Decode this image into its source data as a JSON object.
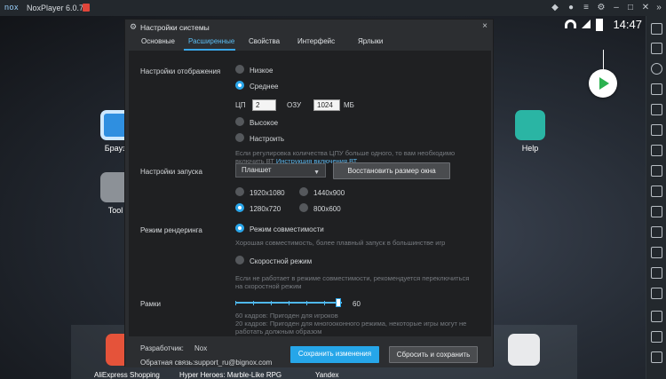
{
  "emulator": {
    "logo": "nox",
    "title": "NoxPlayer 6.0.7.2"
  },
  "statusbar": {
    "time": "14:47"
  },
  "home": {
    "apps": [
      {
        "label": "Брауз"
      },
      {
        "label": "Help"
      },
      {
        "label": "Tool"
      }
    ],
    "dock": [
      {
        "label": "AliExpress Shopping"
      },
      {
        "label": "Hyper Heroes: Marble-Like RPG"
      },
      {
        "label": "Yandex"
      }
    ]
  },
  "dialog": {
    "title": "Настройки системы",
    "tabs": [
      {
        "label": "Основные"
      },
      {
        "label": "Расширенные"
      },
      {
        "label": "Свойства"
      },
      {
        "label": "Интерфейс"
      },
      {
        "label": "Ярлыки"
      }
    ],
    "active_tab": "Расширенные",
    "display": {
      "label": "Настройки отображения",
      "options": [
        "Низкое",
        "Среднее",
        "Высокое",
        "Настроить"
      ],
      "selected": "Среднее",
      "cpu_label": "ЦП",
      "cpu_value": "2",
      "ram_label": "ОЗУ",
      "ram_value": "1024",
      "ram_unit": "МБ",
      "hint_text": "Если регулировка количества ЦПУ больше одного, то вам необходимо",
      "hint_text_2": "включить ВТ",
      "hint_link": "Инструкция включения ВТ"
    },
    "startup": {
      "label": "Настройки запуска",
      "device": "Планшет",
      "restore_button": "Восстановить размер окна",
      "resolutions": [
        "1920x1080",
        "1440x900",
        "1280x720",
        "800x600"
      ],
      "selected": "1280x720"
    },
    "render": {
      "label": "Режим рендеринга",
      "compat_label": "Режим совместимости",
      "compat_desc": "Хорошая совместимость, более плавный запуск в большинстве игр",
      "speed_label": "Скоростной режим",
      "speed_desc_1": "Если не работает в режиме совместимости, рекомендуется переключиться",
      "speed_desc_2": "на скоростной режим",
      "selected": "Режим совместимости"
    },
    "frames": {
      "label": "Рамки",
      "value": "60",
      "fraction": 0.9,
      "desc_1": "60 кадров: Пригоден для игроков",
      "desc_2": "20 кадров: Пригоден для многооконного режима, некоторые игры могут не",
      "desc_3": "работать должным образом"
    },
    "footer": {
      "developer_label": "Разработчик:",
      "developer_value": "Nox",
      "feedback_label": "Обратная связь:",
      "feedback_value": "support_ru@bignox.com",
      "save_button": "Сохранить изменения",
      "reset_button": "Сбросить и сохранить"
    }
  }
}
